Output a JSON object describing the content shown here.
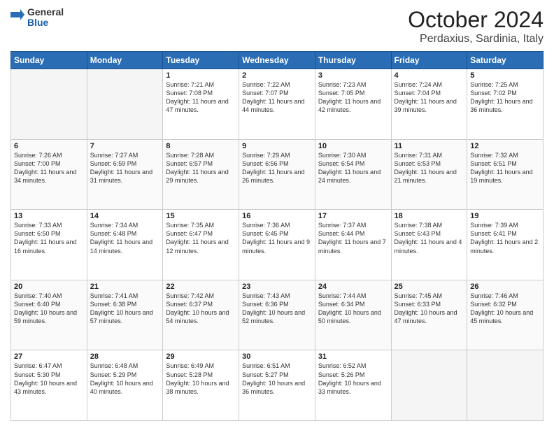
{
  "logo": {
    "general": "General",
    "blue": "Blue"
  },
  "title": "October 2024",
  "subtitle": "Perdaxius, Sardinia, Italy",
  "days_header": [
    "Sunday",
    "Monday",
    "Tuesday",
    "Wednesday",
    "Thursday",
    "Friday",
    "Saturday"
  ],
  "weeks": [
    [
      {
        "day": "",
        "info": ""
      },
      {
        "day": "",
        "info": ""
      },
      {
        "day": "1",
        "info": "Sunrise: 7:21 AM\nSunset: 7:08 PM\nDaylight: 11 hours and 47 minutes."
      },
      {
        "day": "2",
        "info": "Sunrise: 7:22 AM\nSunset: 7:07 PM\nDaylight: 11 hours and 44 minutes."
      },
      {
        "day": "3",
        "info": "Sunrise: 7:23 AM\nSunset: 7:05 PM\nDaylight: 11 hours and 42 minutes."
      },
      {
        "day": "4",
        "info": "Sunrise: 7:24 AM\nSunset: 7:04 PM\nDaylight: 11 hours and 39 minutes."
      },
      {
        "day": "5",
        "info": "Sunrise: 7:25 AM\nSunset: 7:02 PM\nDaylight: 11 hours and 36 minutes."
      }
    ],
    [
      {
        "day": "6",
        "info": "Sunrise: 7:26 AM\nSunset: 7:00 PM\nDaylight: 11 hours and 34 minutes."
      },
      {
        "day": "7",
        "info": "Sunrise: 7:27 AM\nSunset: 6:59 PM\nDaylight: 11 hours and 31 minutes."
      },
      {
        "day": "8",
        "info": "Sunrise: 7:28 AM\nSunset: 6:57 PM\nDaylight: 11 hours and 29 minutes."
      },
      {
        "day": "9",
        "info": "Sunrise: 7:29 AM\nSunset: 6:56 PM\nDaylight: 11 hours and 26 minutes."
      },
      {
        "day": "10",
        "info": "Sunrise: 7:30 AM\nSunset: 6:54 PM\nDaylight: 11 hours and 24 minutes."
      },
      {
        "day": "11",
        "info": "Sunrise: 7:31 AM\nSunset: 6:53 PM\nDaylight: 11 hours and 21 minutes."
      },
      {
        "day": "12",
        "info": "Sunrise: 7:32 AM\nSunset: 6:51 PM\nDaylight: 11 hours and 19 minutes."
      }
    ],
    [
      {
        "day": "13",
        "info": "Sunrise: 7:33 AM\nSunset: 6:50 PM\nDaylight: 11 hours and 16 minutes."
      },
      {
        "day": "14",
        "info": "Sunrise: 7:34 AM\nSunset: 6:48 PM\nDaylight: 11 hours and 14 minutes."
      },
      {
        "day": "15",
        "info": "Sunrise: 7:35 AM\nSunset: 6:47 PM\nDaylight: 11 hours and 12 minutes."
      },
      {
        "day": "16",
        "info": "Sunrise: 7:36 AM\nSunset: 6:45 PM\nDaylight: 11 hours and 9 minutes."
      },
      {
        "day": "17",
        "info": "Sunrise: 7:37 AM\nSunset: 6:44 PM\nDaylight: 11 hours and 7 minutes."
      },
      {
        "day": "18",
        "info": "Sunrise: 7:38 AM\nSunset: 6:43 PM\nDaylight: 11 hours and 4 minutes."
      },
      {
        "day": "19",
        "info": "Sunrise: 7:39 AM\nSunset: 6:41 PM\nDaylight: 11 hours and 2 minutes."
      }
    ],
    [
      {
        "day": "20",
        "info": "Sunrise: 7:40 AM\nSunset: 6:40 PM\nDaylight: 10 hours and 59 minutes."
      },
      {
        "day": "21",
        "info": "Sunrise: 7:41 AM\nSunset: 6:38 PM\nDaylight: 10 hours and 57 minutes."
      },
      {
        "day": "22",
        "info": "Sunrise: 7:42 AM\nSunset: 6:37 PM\nDaylight: 10 hours and 54 minutes."
      },
      {
        "day": "23",
        "info": "Sunrise: 7:43 AM\nSunset: 6:36 PM\nDaylight: 10 hours and 52 minutes."
      },
      {
        "day": "24",
        "info": "Sunrise: 7:44 AM\nSunset: 6:34 PM\nDaylight: 10 hours and 50 minutes."
      },
      {
        "day": "25",
        "info": "Sunrise: 7:45 AM\nSunset: 6:33 PM\nDaylight: 10 hours and 47 minutes."
      },
      {
        "day": "26",
        "info": "Sunrise: 7:46 AM\nSunset: 6:32 PM\nDaylight: 10 hours and 45 minutes."
      }
    ],
    [
      {
        "day": "27",
        "info": "Sunrise: 6:47 AM\nSunset: 5:30 PM\nDaylight: 10 hours and 43 minutes."
      },
      {
        "day": "28",
        "info": "Sunrise: 6:48 AM\nSunset: 5:29 PM\nDaylight: 10 hours and 40 minutes."
      },
      {
        "day": "29",
        "info": "Sunrise: 6:49 AM\nSunset: 5:28 PM\nDaylight: 10 hours and 38 minutes."
      },
      {
        "day": "30",
        "info": "Sunrise: 6:51 AM\nSunset: 5:27 PM\nDaylight: 10 hours and 36 minutes."
      },
      {
        "day": "31",
        "info": "Sunrise: 6:52 AM\nSunset: 5:26 PM\nDaylight: 10 hours and 33 minutes."
      },
      {
        "day": "",
        "info": ""
      },
      {
        "day": "",
        "info": ""
      }
    ]
  ]
}
